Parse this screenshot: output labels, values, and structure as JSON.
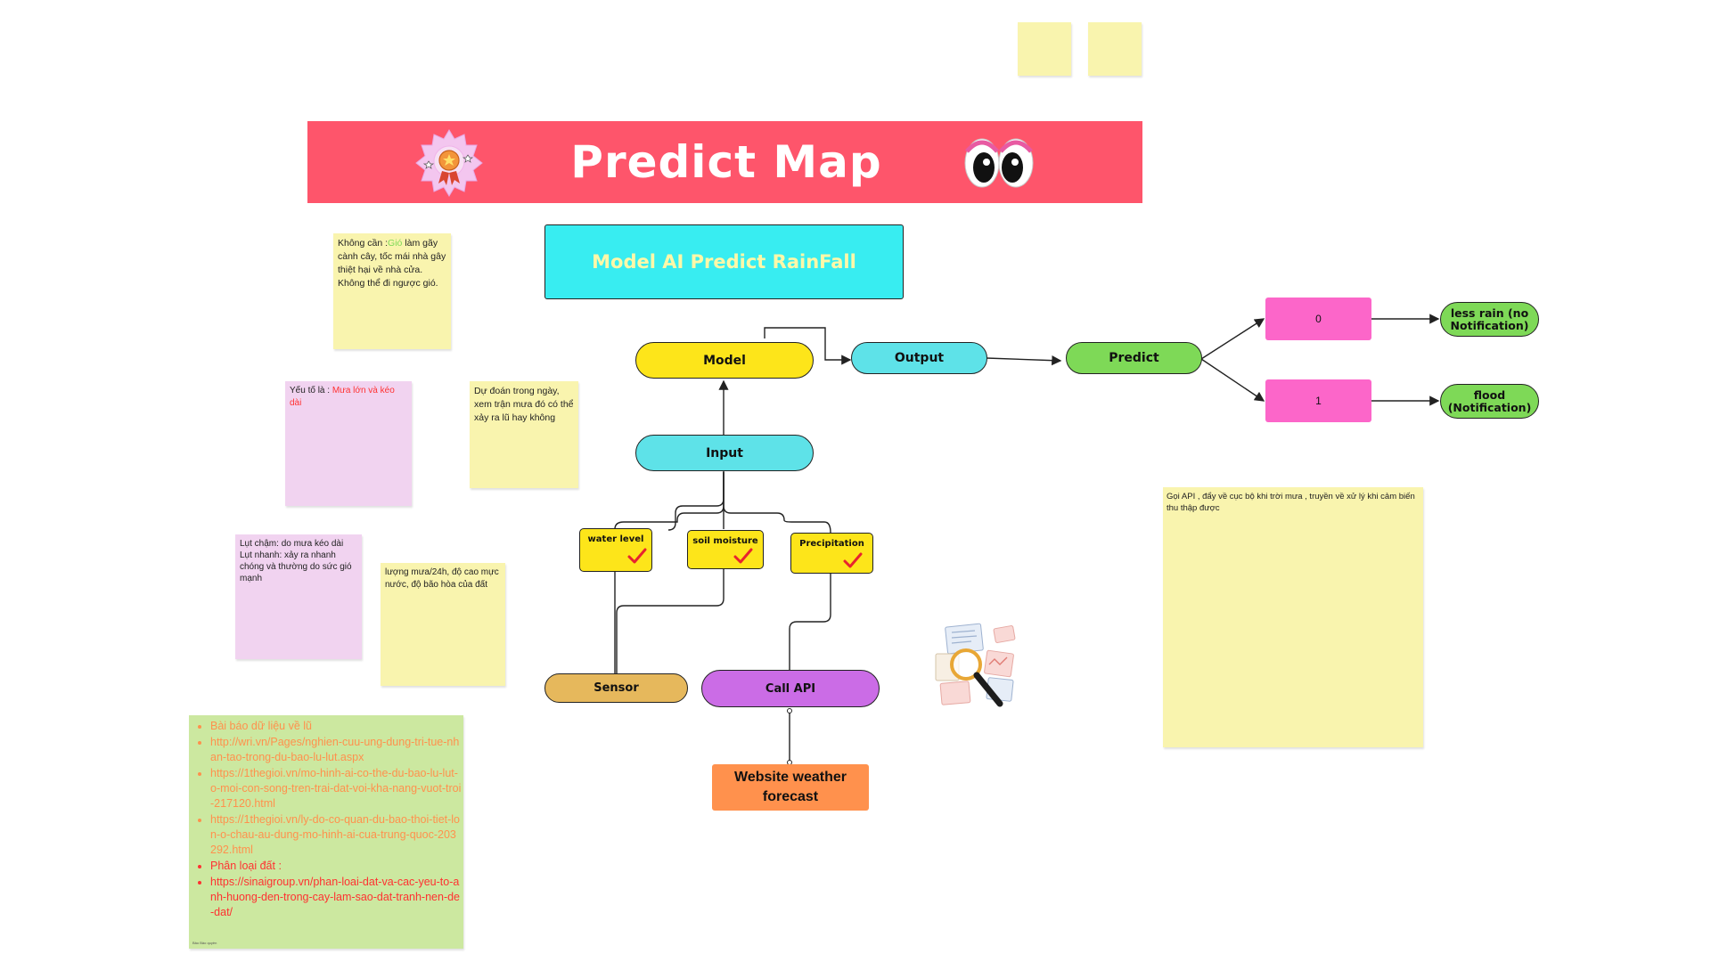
{
  "colors": {
    "banner": "#fe556b",
    "sticky_yellow": "#f9f4ae",
    "sticky_pink": "#f1d3f0",
    "sticky_green": "#cce8a0",
    "model": "#fde51a",
    "cyan": "#5ee2e8",
    "model_ai": "#38edf1",
    "predict": "#7ed957",
    "pink_box": "#fc66c9",
    "sensor": "#e6b85c",
    "call_api": "#cb6ce6",
    "website": "#ff914d",
    "check": "#e8232e"
  },
  "header": {
    "title": "Predict Map"
  },
  "model_ai": {
    "label": "Model AI Predict RainFall"
  },
  "flow": {
    "model": "Model",
    "output": "Output",
    "predict": "Predict",
    "input": "Input",
    "water_level": "water level",
    "soil_moisture": "soil moisture",
    "precipitation": "Precipitation",
    "sensor": "Sensor",
    "call_api": "Call API",
    "website": "Website weather forecast",
    "zero": "0",
    "one": "1",
    "less_rain": "less rain (no Notification)",
    "flood": "flood (Notification)"
  },
  "notes": {
    "wind": {
      "prefix": "Không cần :",
      "highlight": "Gió",
      "rest": " làm gãy cành cây, tốc mái nhà gây thiệt hại về nhà cửa. Không thể đi ngược gió."
    },
    "factor": {
      "prefix": "Yếu tố là : ",
      "highlight": "Mưa lớn và kéo dài"
    },
    "forecast": "Dự đoán trong ngày, xem trận mưa đó có thể xảy ra lũ hay không",
    "flood_types": {
      "line1": "Lụt chậm: do mưa kéo dài",
      "line2": "Lụt nhanh: xảy ra nhanh chóng và thường do sức gió mạnh"
    },
    "rain_metrics": "lượng mưa/24h, độ cao mực nước, độ bão hòa của đất",
    "api": "Gọi API , đẩy về cục bộ khi trời mưa , truyền về xử lý khi cảm biến thu thập được"
  },
  "references": {
    "items": [
      {
        "text": "Bài báo dữ liệu về lũ",
        "tone": "orange"
      },
      {
        "text": "http://wri.vn/Pages/nghien-cuu-ung-dung-tri-tue-nhan-tao-trong-du-bao-lu-lut.aspx",
        "tone": "orange"
      },
      {
        "text": "https://1thegioi.vn/mo-hinh-ai-co-the-du-bao-lu-lut-o-moi-con-song-tren-trai-dat-voi-kha-nang-vuot-troi-217120.html",
        "tone": "orange"
      },
      {
        "text": "https://1thegioi.vn/ly-do-co-quan-du-bao-thoi-tiet-lon-o-chau-au-dung-mo-hinh-ai-cua-trung-quoc-203292.html",
        "tone": "orange"
      },
      {
        "text": "Phân loại đất :",
        "tone": "red"
      },
      {
        "text": "https://sinaigroup.vn/phan-loai-dat-va-cac-yeu-to-anh-huong-den-trong-cay-lam-sao-dat-tranh-nen-de-dat/",
        "tone": "red"
      }
    ],
    "footer": "Bảo Bảo quyền"
  },
  "icons": {
    "badge": "award-badge-icon",
    "eyes": "eyes-icon",
    "check": "checkmark-icon",
    "research": "magnifier-documents-icon"
  }
}
